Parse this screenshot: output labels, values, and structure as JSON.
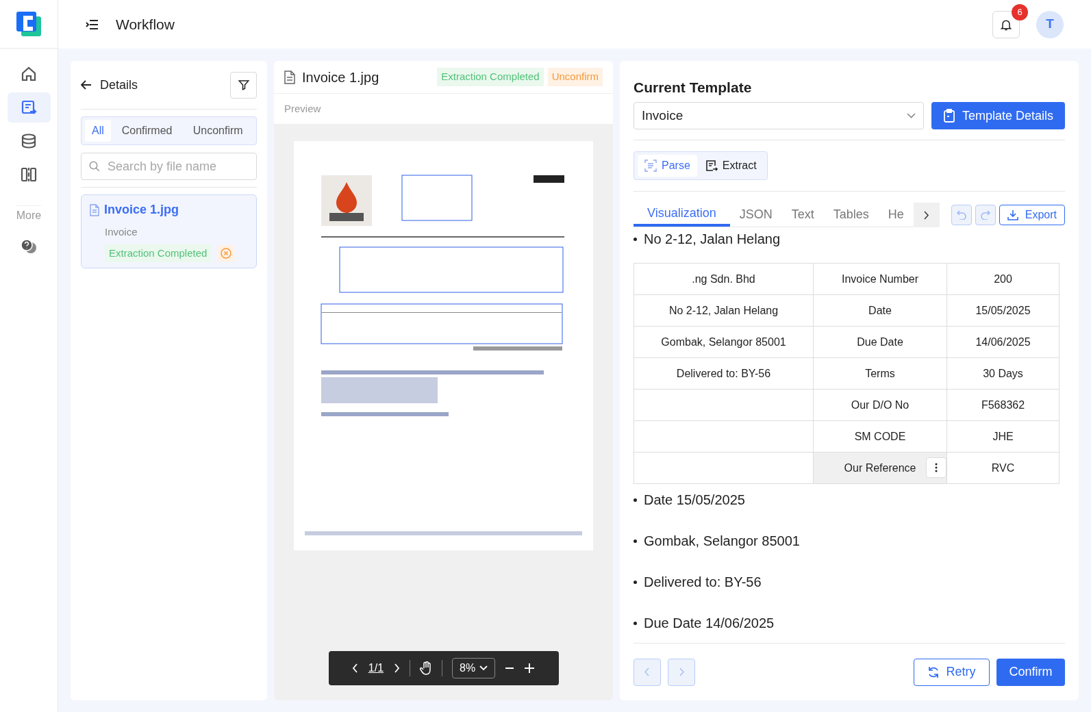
{
  "app": {
    "title": "Workflow",
    "notifications": "6",
    "avatar": "T"
  },
  "nav": [
    {
      "selected": false
    },
    {
      "selected": true
    },
    {
      "selected": false
    },
    {
      "selected": false
    }
  ],
  "nav_more": "More",
  "details": {
    "title": "Details",
    "filters": [
      {
        "label": "All",
        "selected": true
      },
      {
        "label": "Confirmed",
        "selected": false
      },
      {
        "label": "Unconfirm",
        "selected": false
      }
    ],
    "search": {
      "placeholder": "Search by file name"
    },
    "files": [
      {
        "name": "Invoice 1.jpg",
        "template": "Invoice",
        "status": "Extraction Completed",
        "selected": true
      }
    ]
  },
  "preview": {
    "file": "Invoice 1.jpg",
    "badges": [
      {
        "label": "Extraction Completed",
        "kind": "success"
      },
      {
        "label": "Unconfirm",
        "kind": "warning"
      }
    ],
    "label": "Preview",
    "toolbar": {
      "page": "1/1",
      "zoom": "8%"
    }
  },
  "template": {
    "title": "Current Template",
    "selected": "Invoice",
    "details_button": "Template Details",
    "modes": [
      {
        "label": "Parse",
        "selected": true
      },
      {
        "label": "Extract",
        "selected": false
      }
    ],
    "tabs": [
      {
        "label": "Visualization",
        "selected": true
      },
      {
        "label": "JSON",
        "selected": false
      },
      {
        "label": "Text",
        "selected": false
      },
      {
        "label": "Tables",
        "selected": false
      },
      {
        "label": "He",
        "selected": false
      }
    ],
    "export": "Export",
    "top_item": "No 2-12, Jalan Helang",
    "table": [
      {
        "cells": [
          ".ng Sdn. Bhd",
          "Invoice Number",
          "200"
        ],
        "selected": false
      },
      {
        "cells": [
          "No 2-12, Jalan Helang",
          "Date",
          "15/05/2025"
        ],
        "selected": false
      },
      {
        "cells": [
          "Gombak, Selangor 85001",
          "Due Date",
          "14/06/2025"
        ],
        "selected": false
      },
      {
        "cells": [
          "Delivered to: BY-56",
          "Terms",
          "30 Days"
        ],
        "selected": false
      },
      {
        "cells": [
          null,
          "Our D/O No",
          "F568362"
        ],
        "selected": false
      },
      {
        "cells": [
          null,
          "SM CODE",
          "JHE"
        ],
        "selected": false
      },
      {
        "cells": [
          null,
          "Our Reference",
          "RVC"
        ],
        "selected": true
      }
    ],
    "items": [
      "Date 15/05/2025",
      "Gombak, Selangor 85001",
      "Delivered to: BY-56",
      "Due Date 14/06/2025"
    ],
    "retry": "Retry",
    "confirm": "Confirm"
  }
}
